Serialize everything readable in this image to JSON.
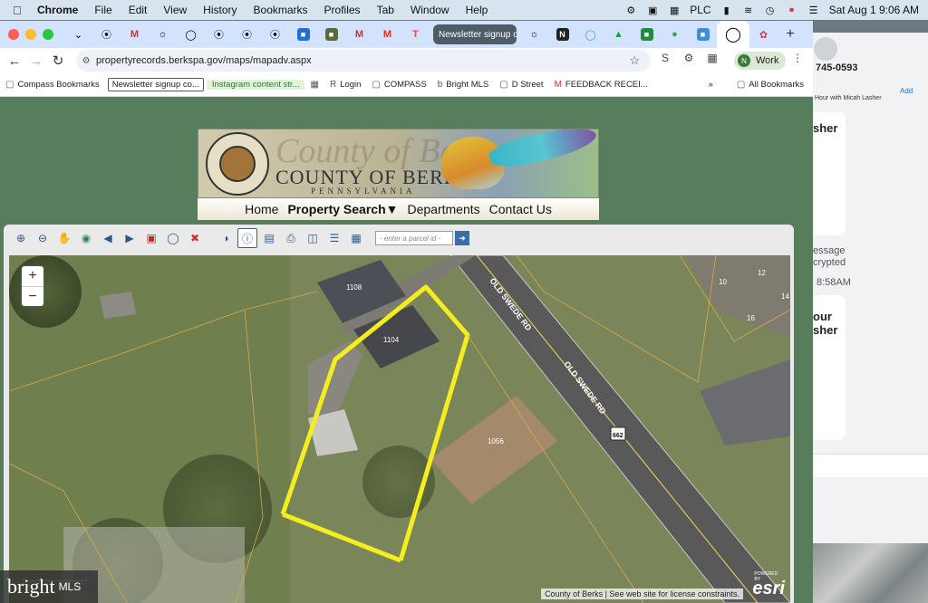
{
  "menubar": {
    "app_name": "Chrome",
    "items": [
      "File",
      "Edit",
      "View",
      "History",
      "Bookmarks",
      "Profiles",
      "Tab",
      "Window",
      "Help"
    ],
    "plc_label": "PLC",
    "datetime": "Sat Aug 1  9:06 AM"
  },
  "tabs": {
    "named_tab_title": "Newsletter signup c..."
  },
  "toolbar": {
    "url": "propertyrecords.berkspa.gov/maps/mapadv.aspx",
    "profile_name": "Work",
    "profile_initial": "N"
  },
  "bookmarks": {
    "compass_bookmarks": "Compass Bookmarks",
    "newsletter": "Newsletter signup co...",
    "instagram": "Instagram content str...",
    "login": "Login",
    "compass": "COMPASS",
    "bright_mls": "Bright MLS",
    "d_street": "D Street",
    "feedback": "FEEDBACK RECEI...",
    "all_bookmarks": "All Bookmarks"
  },
  "banner": {
    "county_script": "County of Berks",
    "county_caps": "COUNTY OF BERKS",
    "state": "PENNSYLVANIA",
    "seal_ring": "LIBERTY · INDEPENDENCE · BERKS COUNTY"
  },
  "sitenav": {
    "home": "Home",
    "property_search": "Property Search▼",
    "departments": "Departments",
    "contact": "Contact Us"
  },
  "map": {
    "parcel_placeholder": "- enter a parcel id -",
    "zoom_in": "+",
    "zoom_out": "−",
    "road_label_1": "OLD SWEDE RD",
    "road_label_2": "OLD SWEDE RD",
    "route_shield": "662",
    "house_labels": [
      "1108",
      "1104",
      "1056",
      "10",
      "12",
      "14",
      "16"
    ],
    "attribution": "County of Berks | See web site for license constraints.",
    "esri": "esri",
    "esri_powered": "POWERED BY"
  },
  "messages": {
    "phone": "745-0593",
    "hour_line": "Hour with Micah Lasher",
    "add": "Add",
    "snippets": [
      "sher",
      "essage",
      "crypted",
      "8:58AM",
      "our",
      "sher"
    ]
  },
  "overlay": {
    "bright_word": "bright",
    "mls": "MLS"
  },
  "colors": {
    "parcel_outline": "#f5ee1f",
    "tabstrip": "#d3e3fd",
    "page_bg": "#587d5c"
  }
}
